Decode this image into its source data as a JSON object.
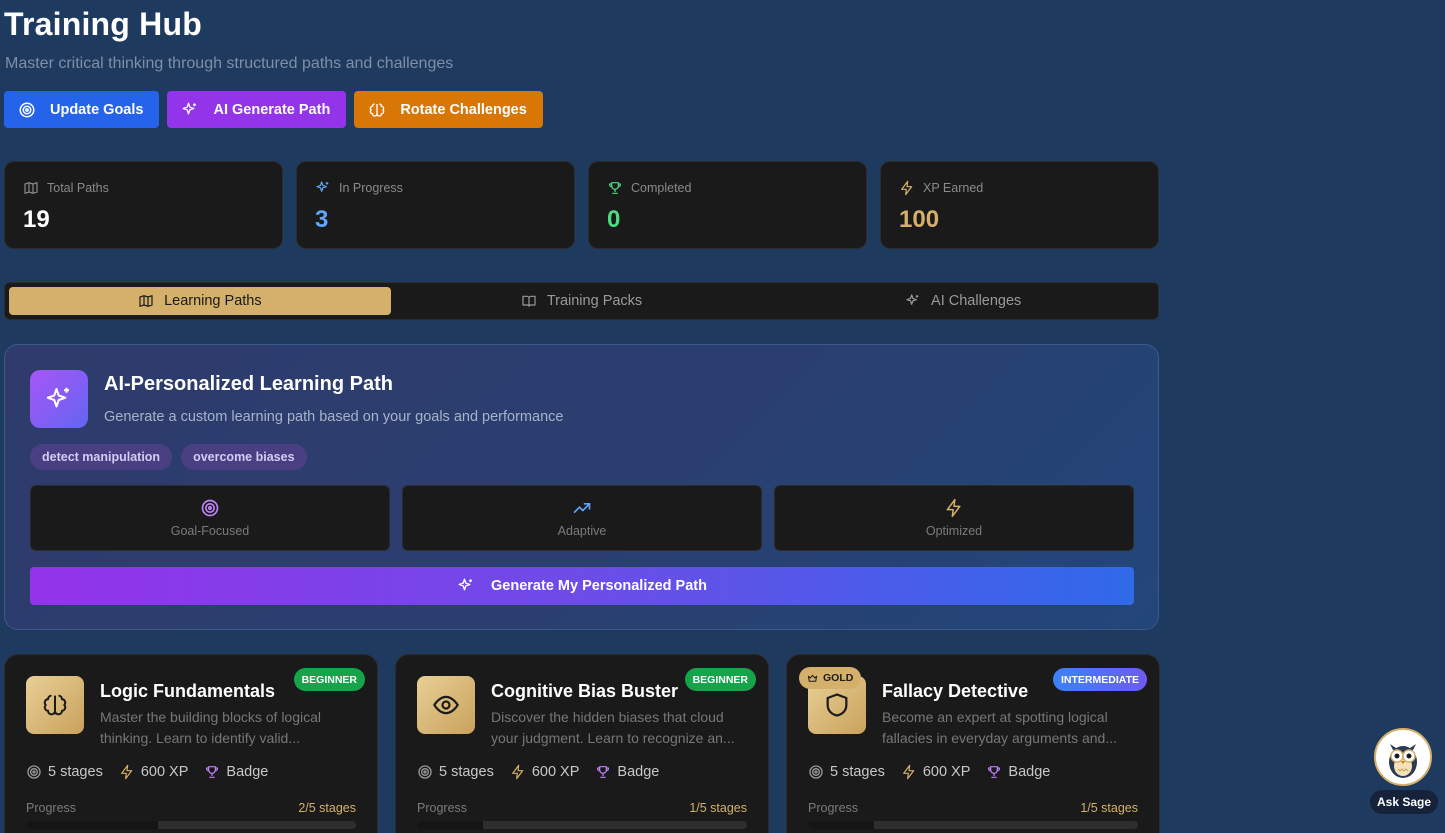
{
  "header": {
    "title": "Training Hub",
    "subtitle": "Master critical thinking through structured paths and challenges"
  },
  "actions": {
    "update_goals": "Update Goals",
    "ai_generate": "AI Generate Path",
    "rotate": "Rotate Challenges"
  },
  "stats": [
    {
      "label": "Total Paths",
      "value": "19",
      "color": "#ffffff",
      "icon": "map-icon"
    },
    {
      "label": "In Progress",
      "value": "3",
      "color": "#60a5fa",
      "icon": "sparkles-icon"
    },
    {
      "label": "Completed",
      "value": "0",
      "color": "#4ade80",
      "icon": "trophy-icon"
    },
    {
      "label": "XP Earned",
      "value": "100",
      "color": "#d4b06a",
      "icon": "zap-icon"
    }
  ],
  "tabs": [
    {
      "label": "Learning Paths",
      "active": true
    },
    {
      "label": "Training Packs",
      "active": false
    },
    {
      "label": "AI Challenges",
      "active": false
    }
  ],
  "ai_card": {
    "title": "AI-Personalized Learning Path",
    "description": "Generate a custom learning path based on your goals and performance",
    "chips": [
      "detect manipulation",
      "overcome biases"
    ],
    "features": [
      {
        "label": "Goal-Focused",
        "icon": "target-icon",
        "color": "#c084fc"
      },
      {
        "label": "Adaptive",
        "icon": "trending-up-icon",
        "color": "#60a5fa"
      },
      {
        "label": "Optimized",
        "icon": "zap-icon",
        "color": "#d4b06a"
      }
    ],
    "generate_label": "Generate My Personalized Path"
  },
  "paths": [
    {
      "title": "Logic Fundamentals",
      "badge": "BEGINNER",
      "description": "Master the building blocks of logical thinking. Learn to identify valid...",
      "stages": "5 stages",
      "xp": "600 XP",
      "reward": "Badge",
      "progress_label": "Progress",
      "progress_text": "2/5 stages",
      "progress": 0.4,
      "icon": "brain-icon"
    },
    {
      "title": "Cognitive Bias Buster",
      "badge": "BEGINNER",
      "description": "Discover the hidden biases that cloud your judgment. Learn to recognize an...",
      "stages": "5 stages",
      "xp": "600 XP",
      "reward": "Badge",
      "progress_label": "Progress",
      "progress_text": "1/5 stages",
      "progress": 0.2,
      "icon": "eye-icon"
    },
    {
      "title": "Fallacy Detective",
      "badge": "INTERMEDIATE",
      "tag": "GOLD",
      "description": "Become an expert at spotting logical fallacies in everyday arguments and...",
      "stages": "5 stages",
      "xp": "600 XP",
      "reward": "Badge",
      "progress_label": "Progress",
      "progress_text": "1/5 stages",
      "progress": 0.2,
      "icon": "shield-icon"
    }
  ],
  "assistant": {
    "label": "Ask Sage"
  }
}
